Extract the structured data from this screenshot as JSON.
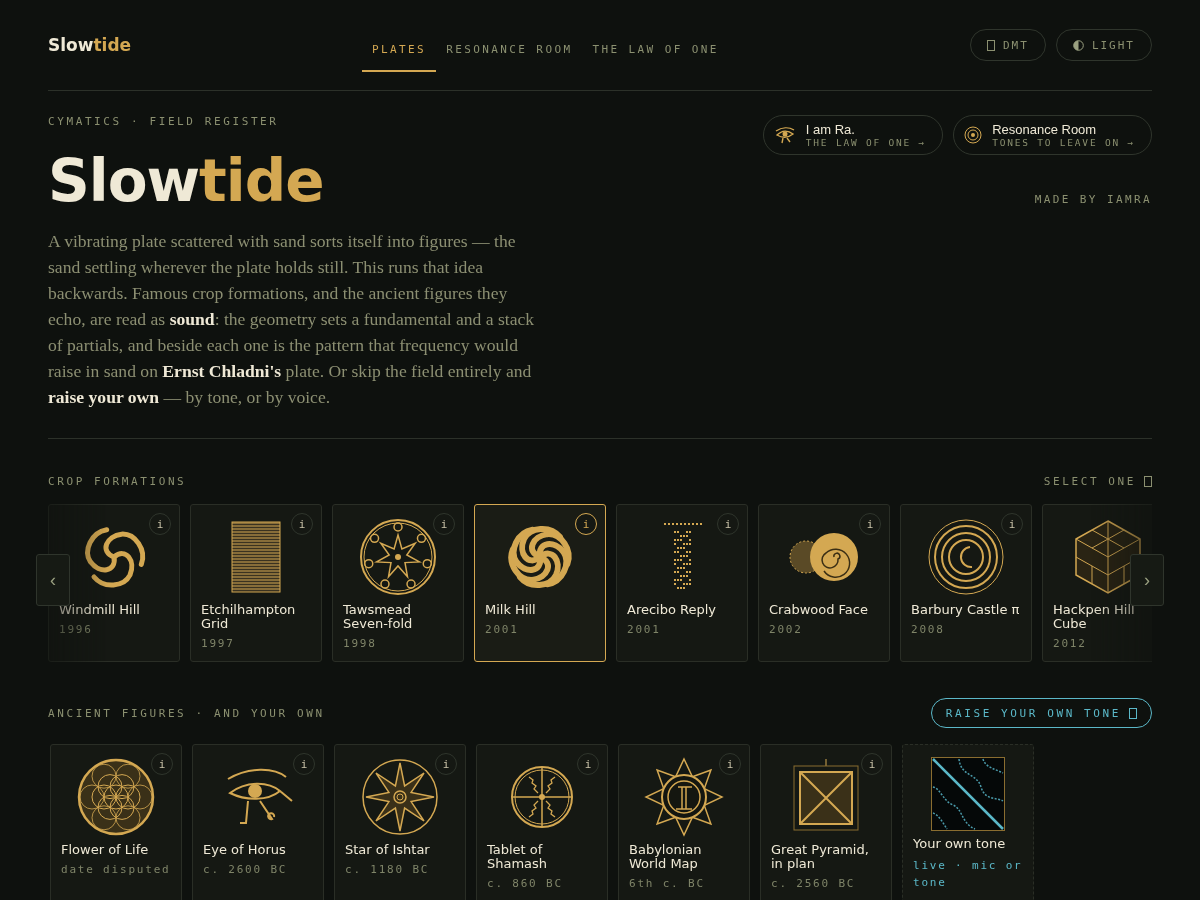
{
  "header": {
    "logo": [
      "Slow",
      "tide"
    ],
    "tabs": [
      {
        "label": "PLATES",
        "selected": true
      },
      {
        "label": "RESONANCE ROOM",
        "selected": false
      },
      {
        "label": "THE LAW OF ONE",
        "selected": false
      }
    ],
    "buttons": [
      {
        "label": "DMT",
        "kind": "box"
      },
      {
        "label": "LIGHT",
        "kind": "half"
      }
    ]
  },
  "hero": {
    "eyebrow": "CYMATICS · FIELD REGISTER",
    "title": [
      "Slow",
      "tide"
    ],
    "text": "A vibrating plate scattered with sand sorts itself into figures — the sand settling wherever the plate holds still. This runs that idea backwards. Famous crop formations, and the ancient figures they echo, are read as **sound**: the geometry sets a fundamental and a stack of partials, and beside each one is the pattern that frequency would raise in sand on **Ernst Chladni's** plate. Or skip the field entirely and **raise your own** — by tone, or by voice.",
    "links": [
      {
        "kind": "eye",
        "title": "I am Ra.",
        "sub": "THE LAW OF ONE →"
      },
      {
        "kind": "rings",
        "title": "Resonance Room",
        "sub": "TONES TO LEAVE ON →"
      }
    ],
    "credit": "MADE BY IAMRA"
  },
  "crops": {
    "heading": "CROP FORMATIONS",
    "hint": "SELECT ONE",
    "prev": "‹",
    "next": "›",
    "items": [
      {
        "name": "Windmill Hill",
        "year": "1996",
        "info": "i",
        "selected": false
      },
      {
        "name": "Etchilhampton Grid",
        "year": "1997",
        "info": "i",
        "selected": false
      },
      {
        "name": "Tawsmead Seven-fold",
        "year": "1998",
        "info": "i",
        "selected": false
      },
      {
        "name": "Milk Hill",
        "year": "2001",
        "info": "i",
        "selected": true
      },
      {
        "name": "Arecibo Reply",
        "year": "2001",
        "info": "i",
        "selected": false
      },
      {
        "name": "Crabwood Face",
        "year": "2002",
        "info": "i",
        "selected": false
      },
      {
        "name": "Barbury Castle π",
        "year": "2008",
        "info": "i",
        "selected": false
      },
      {
        "name": "Hackpen Hill Cube",
        "year": "2012",
        "selected": false
      }
    ]
  },
  "ancient": {
    "heading": "ANCIENT FIGURES · AND YOUR OWN",
    "button": "RAISE YOUR OWN TONE",
    "items": [
      {
        "kind": "figure",
        "name": "Flower of Life",
        "date": "date disputed",
        "info": "i"
      },
      {
        "kind": "figure",
        "name": "Eye of Horus",
        "date": "c. 2600 BC",
        "info": "i"
      },
      {
        "kind": "figure",
        "name": "Star of Ishtar",
        "date": "c. 1180 BC",
        "info": "i"
      },
      {
        "kind": "figure",
        "name": "Tablet of Shamash",
        "date": "c. 860 BC",
        "info": "i"
      },
      {
        "kind": "figure",
        "name": "Babylonian World Map",
        "date": "6th c. BC",
        "info": "i"
      },
      {
        "kind": "figure",
        "name": "Great Pyramid, in plan",
        "date": "c. 2560 BC",
        "info": "i"
      },
      {
        "kind": "live",
        "name": "Your own tone",
        "date": "live · mic or tone"
      }
    ]
  }
}
